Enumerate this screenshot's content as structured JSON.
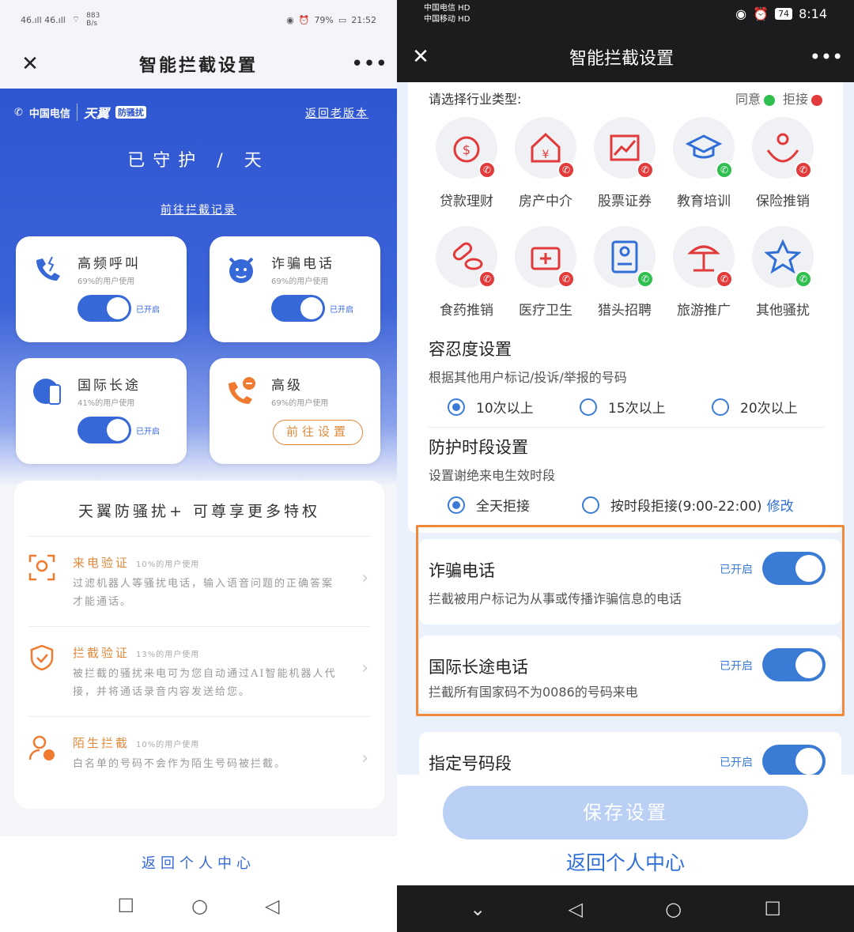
{
  "left": {
    "status": {
      "signal": "46.ıll 46.ıll",
      "speed": "883\nB/s",
      "battery": "79%",
      "time": "21:52"
    },
    "nav": {
      "title": "智能拦截设置",
      "close": "✕",
      "more": "•••"
    },
    "brand": {
      "telecom": "中国电信",
      "product": "天翼",
      "badge": "防骚扰"
    },
    "old_version": "返回老版本",
    "guarded": "已守护 / 天",
    "goto_records": "前往拦截记录",
    "cards": [
      {
        "name": "高频呼叫",
        "usage": "69%的用户使用",
        "state": "已开启"
      },
      {
        "name": "诈骗电话",
        "usage": "69%的用户使用",
        "state": "已开启"
      },
      {
        "name": "国际长途",
        "usage": "41%的用户使用",
        "state": "已开启"
      },
      {
        "name": "高级",
        "usage": "69%的用户使用",
        "action": "前往设置"
      }
    ],
    "privileges": {
      "title": "天翼防骚扰+ 可尊享更多特权",
      "items": [
        {
          "name": "来电验证",
          "usage": "10%的用户使用",
          "desc": "过滤机器人等骚扰电话，输入语音问题的正确答案才能通话。"
        },
        {
          "name": "拦截验证",
          "usage": "13%的用户使用",
          "desc": "被拦截的骚扰来电可为您自动通过AI智能机器人代接，并将通话录音内容发送给您。"
        },
        {
          "name": "陌生拦截",
          "usage": "10%的用户使用",
          "desc": "白名单的号码不会作为陌生号码被拦截。"
        }
      ]
    },
    "back": "返回个人中心"
  },
  "right": {
    "status": {
      "carrier1": "中国电信 HD",
      "carrier2": "中国移动 HD",
      "battery": "74",
      "time": "8:14"
    },
    "nav": {
      "title": "智能拦截设置",
      "close": "✕",
      "more": "•••"
    },
    "industry": {
      "heading": "请选择行业类型:",
      "agree": "同意",
      "reject": "拒接",
      "items": [
        {
          "name": "贷款理财",
          "state": "reject"
        },
        {
          "name": "房产中介",
          "state": "reject"
        },
        {
          "name": "股票证券",
          "state": "reject"
        },
        {
          "name": "教育培训",
          "state": "agree"
        },
        {
          "name": "保险推销",
          "state": "reject"
        },
        {
          "name": "食药推销",
          "state": "reject"
        },
        {
          "name": "医疗卫生",
          "state": "reject"
        },
        {
          "name": "猎头招聘",
          "state": "agree"
        },
        {
          "name": "旅游推广",
          "state": "reject"
        },
        {
          "name": "其他骚扰",
          "state": "agree"
        }
      ]
    },
    "tolerance": {
      "title": "容忍度设置",
      "desc": "根据其他用户标记/投诉/举报的号码",
      "options": [
        "10次以上",
        "15次以上",
        "20次以上"
      ],
      "selected": 0
    },
    "period": {
      "title": "防护时段设置",
      "desc": "设置谢绝来电生效时段",
      "options": [
        "全天拒接",
        "按时段拒接(9:00-22:00)"
      ],
      "edit": "修改",
      "selected": 0
    },
    "features": [
      {
        "title": "诈骗电话",
        "desc": "拦截被用户标记为从事或传播诈骗信息的电话",
        "state": "已开启"
      },
      {
        "title": "国际长途电话",
        "desc": "拦截所有国家码不为0086的号码来电",
        "state": "已开启"
      },
      {
        "title": "指定号码段",
        "desc": "",
        "state": "已开启"
      }
    ],
    "save": "保存设置",
    "back": "返回个人中心"
  },
  "colors": {
    "blue": "#3768d8",
    "orange": "#e08a3c",
    "agree": "#2fbf4f",
    "reject": "#e23a3a",
    "highlight": "#ef8a3a"
  }
}
